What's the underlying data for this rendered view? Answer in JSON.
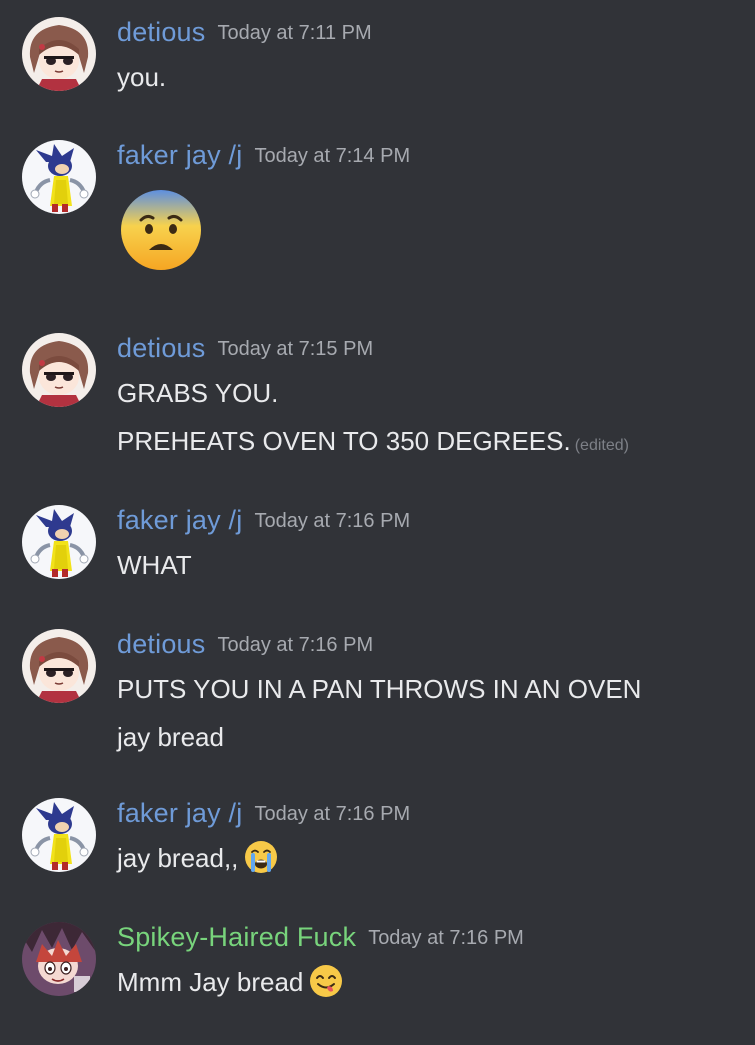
{
  "messages": [
    {
      "author": "detious",
      "time": "Today at 7:11 PM",
      "lines": [
        "you."
      ]
    },
    {
      "author": "faker jay /j",
      "time": "Today at 7:14 PM",
      "emoji": "fearful-face-emoji"
    },
    {
      "author": "detious",
      "time": "Today at 7:15 PM",
      "lines": [
        "GRABS YOU.",
        "PREHEATS OVEN TO 350 DEGREES."
      ],
      "edited_label": "(edited)"
    },
    {
      "author": "faker jay /j",
      "time": "Today at 7:16 PM",
      "lines": [
        "WHAT"
      ]
    },
    {
      "author": "detious",
      "time": "Today at 7:16 PM",
      "lines": [
        "PUTS YOU IN A PAN THROWS IN AN OVEN",
        "jay bread"
      ]
    },
    {
      "author": "faker jay /j",
      "time": "Today at 7:16 PM",
      "lines": [
        "jay bread,,"
      ],
      "emoji": "loudly-crying-face-emoji"
    },
    {
      "author": "Spikey-Haired Fuck",
      "time": "Today at 7:16 PM",
      "lines": [
        "Mmm Jay bread"
      ],
      "emoji": "yum-face-emoji"
    }
  ],
  "colors": {
    "background": "#313338",
    "author_blue": "#6f9bd8",
    "author_green": "#78d47c",
    "timestamp": "#a7aab0",
    "text": "#e9eaec"
  }
}
